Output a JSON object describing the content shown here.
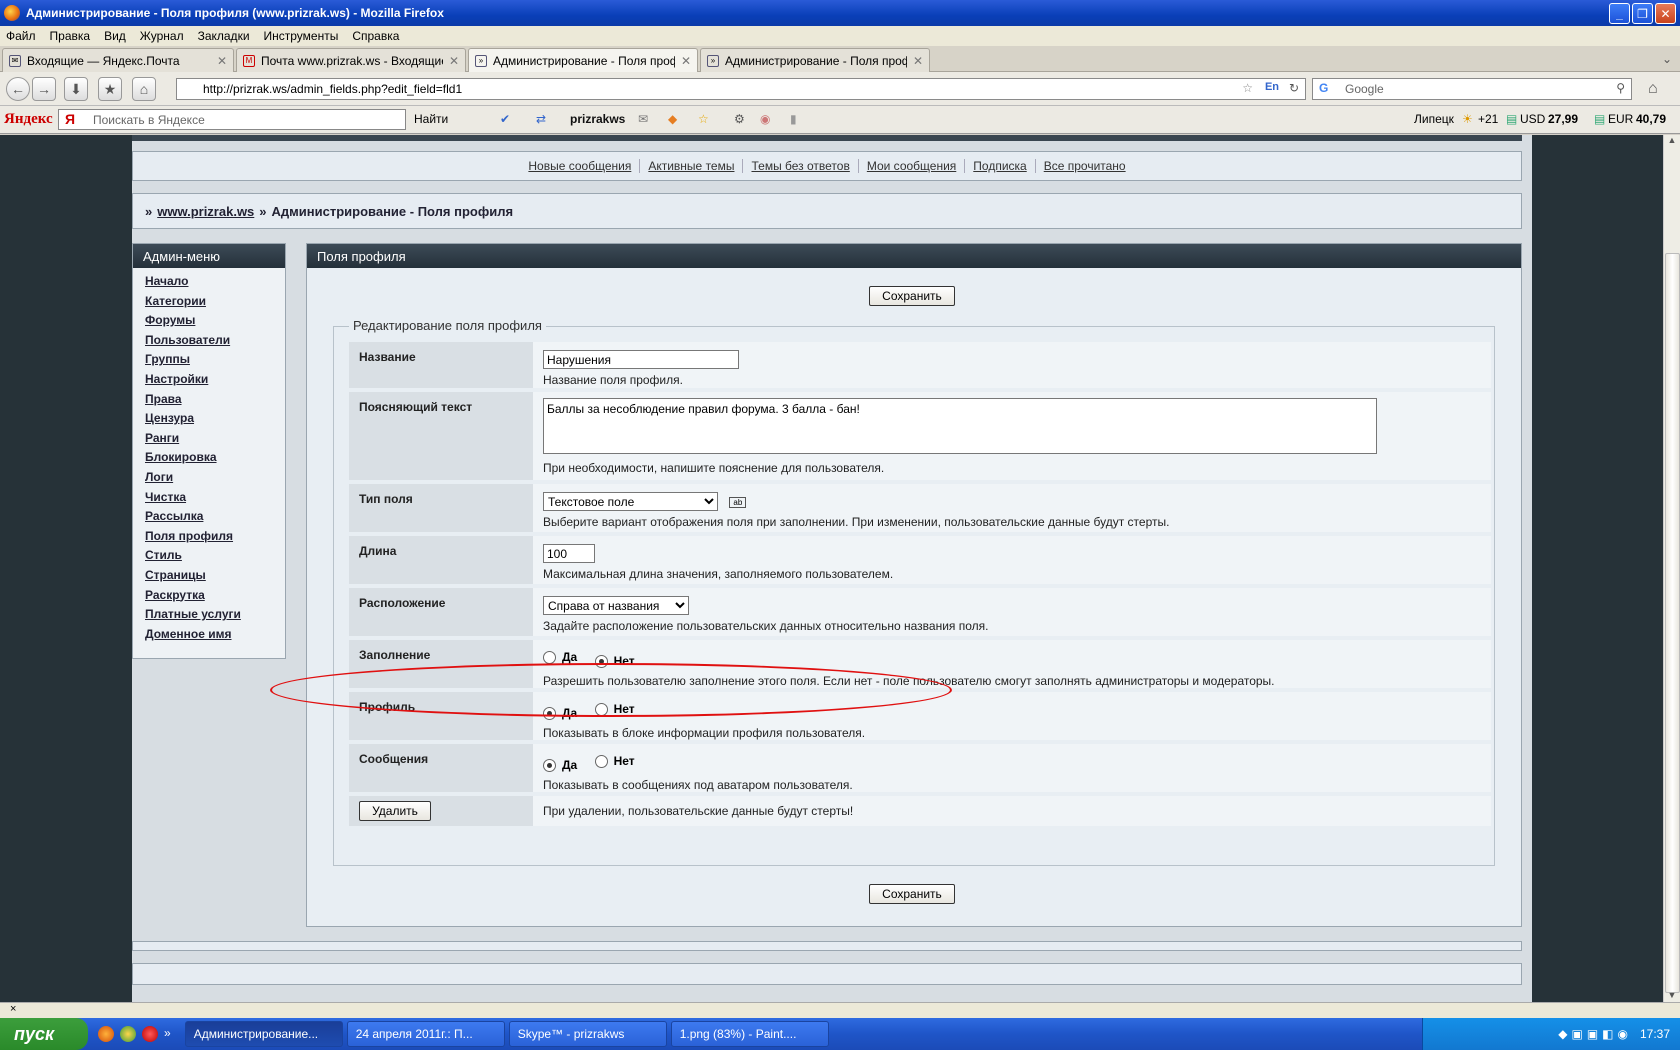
{
  "window": {
    "title": "Администрирование - Поля профиля (www.prizrak.ws) - Mozilla Firefox"
  },
  "menubar": [
    "Файл",
    "Правка",
    "Вид",
    "Журнал",
    "Закладки",
    "Инструменты",
    "Справка"
  ],
  "tabs": [
    {
      "label": "Входящие — Яндекс.Почта"
    },
    {
      "label": "Почта www.prizrak.ws - Входящие - admi..."
    },
    {
      "label": "Администрирование - Поля профиля (w..."
    },
    {
      "label": "Администрирование - Поля профиля (w..."
    }
  ],
  "nav": {
    "url": "http://prizrak.ws/admin_fields.php?edit_field=fld1",
    "search_placeholder": "Google"
  },
  "yandex": {
    "logo": "Яндекс",
    "search_placeholder": "Поискать в Яндексе",
    "find": "Найти",
    "user": "prizrakws",
    "city": "Липецк",
    "temp": "+21",
    "usd_label": "USD",
    "usd": "27,99",
    "eur_label": "EUR",
    "eur": "40,79"
  },
  "quicklinks": [
    "Новые сообщения",
    "Активные темы",
    "Темы без ответов",
    "Мои сообщения",
    "Подписка",
    "Все прочитано"
  ],
  "breadcrumb": {
    "sep": "»",
    "site": "www.prizrak.ws",
    "current": "Администрирование - Поля профиля"
  },
  "admin_menu": {
    "title": "Админ-меню",
    "items": [
      "Начало",
      "Категории",
      "Форумы",
      "Пользователи",
      "Группы",
      "Настройки",
      "Права",
      "Цензура",
      "Ранги",
      "Блокировка",
      "Логи",
      "Чистка",
      "Рассылка",
      "Поля профиля",
      "Стиль",
      "Страницы",
      "Раскрутка",
      "Платные услуги",
      "Доменное имя"
    ]
  },
  "main": {
    "title": "Поля профиля",
    "save": "Сохранить",
    "legend": "Редактирование поля профиля",
    "fields": {
      "name": {
        "label": "Название",
        "value": "Нарушения",
        "desc": "Название поля профиля."
      },
      "hint": {
        "label": "Поясняющий текст",
        "value": "Баллы за несоблюдение правил форума. 3 балла - бан!",
        "desc": "При необходимости, напишите пояснение для пользователя."
      },
      "type": {
        "label": "Тип поля",
        "value": "Текстовое поле",
        "desc": "Выберите вариант отображения поля при заполнении. При изменении, пользовательские данные будут стерты."
      },
      "length": {
        "label": "Длина",
        "value": "100",
        "desc": "Максимальная длина значения, заполняемого пользователем."
      },
      "position": {
        "label": "Расположение",
        "value": "Справа от названия",
        "desc": "Задайте расположение пользовательских данных относительно названия поля."
      },
      "fill": {
        "label": "Заполнение",
        "yes": "Да",
        "no": "Нет",
        "selected": "no",
        "desc": "Разрешить пользователю заполнение этого поля. Если нет - поле пользователю смогут заполнять администраторы и модераторы."
      },
      "profile": {
        "label": "Профиль",
        "yes": "Да",
        "no": "Нет",
        "selected": "yes",
        "desc": "Показывать в блоке информации профиля пользователя."
      },
      "messages": {
        "label": "Сообщения",
        "yes": "Да",
        "no": "Нет",
        "selected": "yes",
        "desc": "Показывать в сообщениях под аватаром пользователя."
      }
    },
    "delete": {
      "button": "Удалить",
      "desc": "При удалении, пользовательские данные будут стерты!"
    }
  },
  "statusbar": {
    "close": "×"
  },
  "taskbar": {
    "start": "пуск",
    "tasks": [
      "Администрирование...",
      "24 апреля 2011г.: П...",
      "Skype™ - prizrakws",
      "1.png (83%) - Paint...."
    ],
    "time": "17:37"
  },
  "colors": {
    "page_bg": "#263238",
    "panel_head": "#2c3a45",
    "annotation": "#e01010"
  }
}
